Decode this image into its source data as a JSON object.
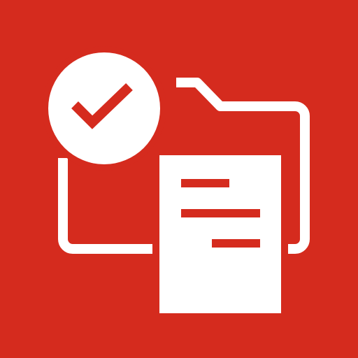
{
  "icon": {
    "background_color": "#d52b1e",
    "foreground_color": "#ffffff",
    "elements": [
      "folder-outline-icon",
      "check-circle-icon",
      "document-icon"
    ]
  }
}
